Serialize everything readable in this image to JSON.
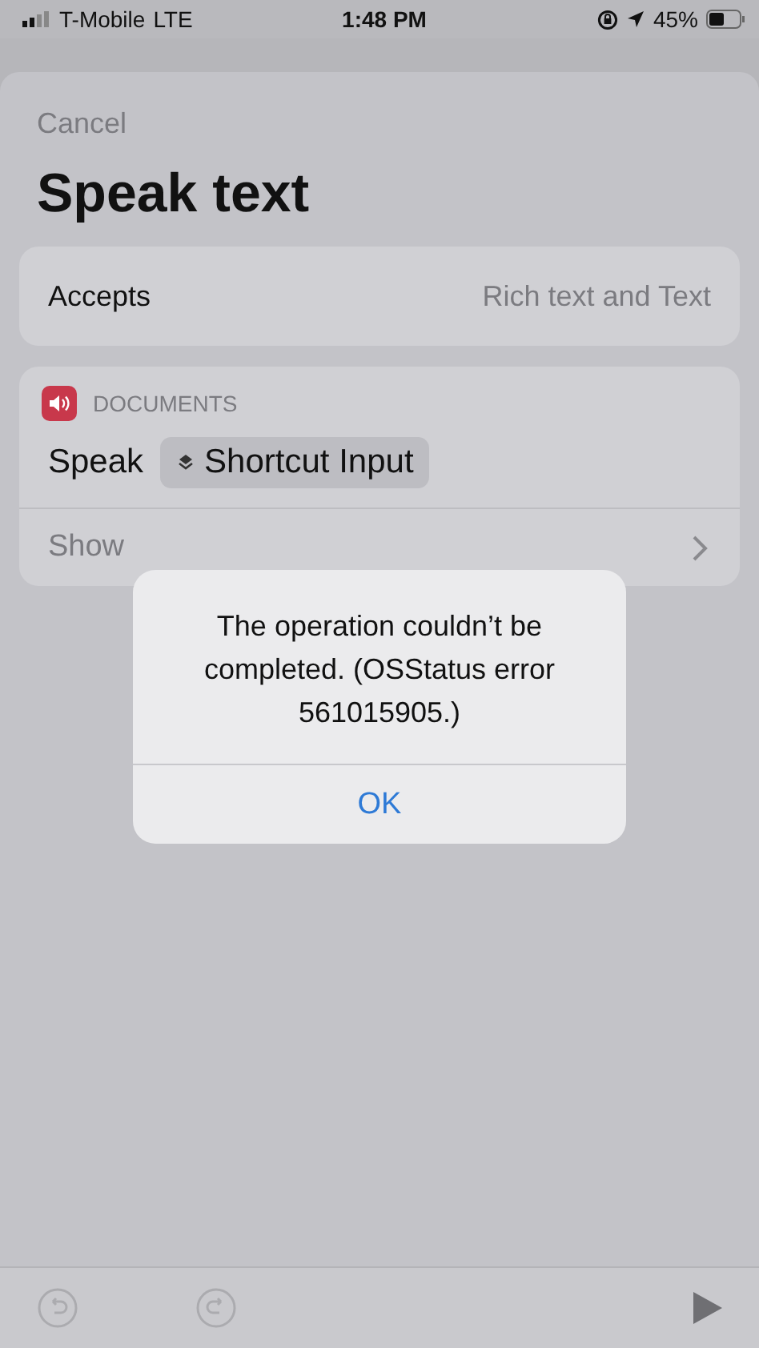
{
  "status_bar": {
    "carrier": "T-Mobile",
    "network": "LTE",
    "time": "1:48 PM",
    "battery": "45%"
  },
  "sheet": {
    "cancel": "Cancel",
    "title": "Speak text"
  },
  "accepts": {
    "label": "Accepts",
    "value": "Rich text and Text"
  },
  "action": {
    "category": "DOCUMENTS",
    "verb": "Speak",
    "variable": "Shortcut Input",
    "show_more": "Show"
  },
  "alert": {
    "message": "The operation couldn’t be completed. (OSStatus error 561015905.)",
    "buttons": [
      "OK"
    ]
  },
  "toolbar": {
    "undo_disabled": true,
    "redo_disabled": true
  }
}
